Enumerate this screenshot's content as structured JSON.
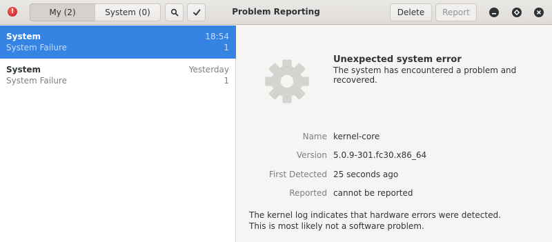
{
  "header": {
    "title": "Problem Reporting",
    "tab_my": "My (2)",
    "tab_system": "System (0)",
    "delete_label": "Delete",
    "report_label": "Report"
  },
  "problems": [
    {
      "title": "System",
      "subtitle": "System Failure",
      "time": "18:54",
      "count": "1"
    },
    {
      "title": "System",
      "subtitle": "System Failure",
      "time": "Yesterday",
      "count": "1"
    }
  ],
  "detail": {
    "heading": "Unexpected system error",
    "description": "The system has encountered a problem and recovered.",
    "fields": [
      {
        "label": "Name",
        "value": "kernel-core"
      },
      {
        "label": "Version",
        "value": "5.0.9-301.fc30.x86_64"
      },
      {
        "label": "First Detected",
        "value": "25 seconds ago"
      },
      {
        "label": "Reported",
        "value": "cannot be reported"
      }
    ],
    "note_line1": "The kernel log indicates that hardware errors were detected.",
    "note_line2": "This is most likely not a software problem."
  },
  "colors": {
    "accent": "#3584e4",
    "app_icon": "#e01b24",
    "gear": "#d5d3d0"
  },
  "icons": {
    "app": "error-icon",
    "search": "search-icon",
    "select": "checkmark-icon",
    "minimize": "minimize-icon",
    "maximize": "maximize-icon",
    "close": "close-icon",
    "problem": "gear-icon"
  }
}
